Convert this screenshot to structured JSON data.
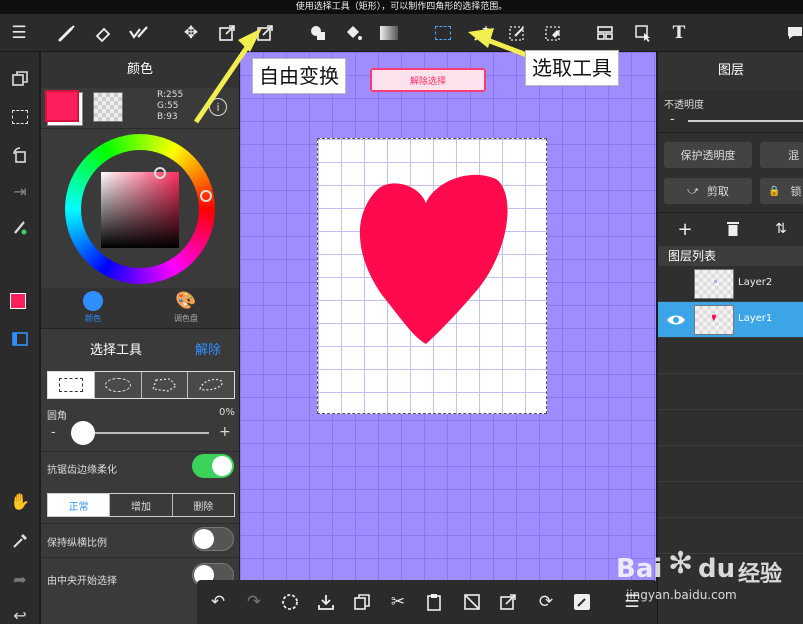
{
  "hint_bar": {
    "text": "使用选择工具（矩形），可以制作四角形的选择范围。"
  },
  "color_panel": {
    "title": "颜色",
    "rgb": {
      "r": "R:255",
      "g": "G:55",
      "b": "B:93"
    },
    "primary_color": "#ff1f5d",
    "tabs": [
      {
        "label": "颜色"
      },
      {
        "label": "调色盘"
      }
    ]
  },
  "selection_panel": {
    "title": "选择工具",
    "clear_label": "解除",
    "shapes": [
      "rectangle",
      "ellipse",
      "polygon",
      "lasso"
    ],
    "corner": {
      "label": "圆角",
      "value_text": "0%",
      "value": 0,
      "minus": "-",
      "plus": "+"
    },
    "antialias": {
      "label": "抗锯齿边缘柔化",
      "on": true
    },
    "modes": [
      {
        "label": "正常"
      },
      {
        "label": "增加"
      },
      {
        "label": "删除"
      }
    ],
    "keep_ratio": {
      "label": "保持纵横比例",
      "on": false
    },
    "from_center": {
      "label": "由中央开始选择",
      "on": false
    }
  },
  "canvas": {
    "deselect_button": "解除选择",
    "heart_color": "#ff0a4c"
  },
  "layers_panel": {
    "title": "图层",
    "opacity_label": "不透明度",
    "opacity_minus": "-",
    "protect_alpha": "保护透明度",
    "blend_partial": "混",
    "clip": "剪取",
    "lock_partial": "锁",
    "list_title": "图层列表",
    "layers": [
      {
        "name": "Layer2"
      },
      {
        "name": "Layer1"
      }
    ]
  },
  "annotations": {
    "free_transform": "自由变换",
    "select_tool": "选取工具"
  },
  "watermark": {
    "logo_text": "Bai",
    "logo_suffix": "du",
    "product": "经验",
    "url": "jingyan.baidu.com"
  }
}
